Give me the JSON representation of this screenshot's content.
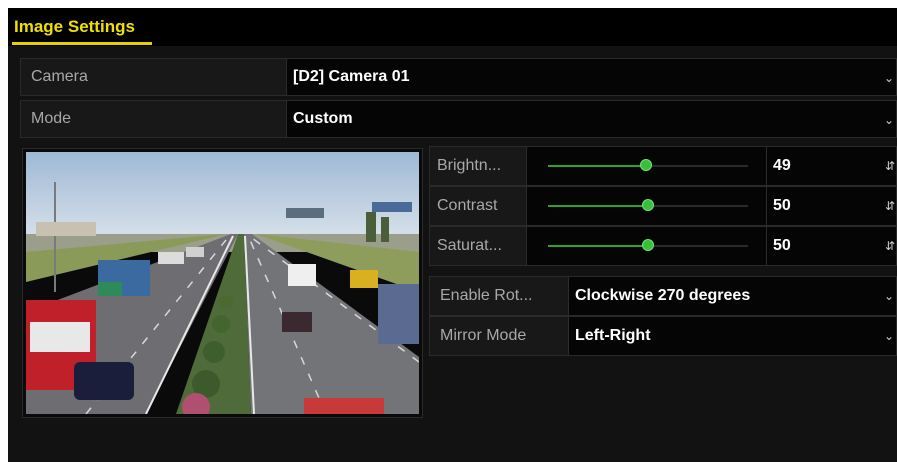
{
  "window": {
    "title": "Image Settings"
  },
  "camera": {
    "label": "Camera",
    "value": "[D2] Camera 01"
  },
  "mode": {
    "label": "Mode",
    "value": "Custom"
  },
  "sliders": [
    {
      "label": "Brightn...",
      "value": "49",
      "level": 0.49
    },
    {
      "label": "Contrast",
      "value": "50",
      "level": 0.5
    },
    {
      "label": "Saturat...",
      "value": "50",
      "level": 0.5
    }
  ],
  "rotate": {
    "label": "Enable Rot...",
    "value": "Clockwise 270 degrees"
  },
  "mirror": {
    "label": "Mirror Mode",
    "value": "Left-Right"
  },
  "icons": {
    "dropdown": "chevron-down-icon",
    "spinner": "up-down-spinner-icon"
  },
  "colors": {
    "accent": "#f0e000",
    "slider": "#2aa52a",
    "background": "#121212"
  }
}
